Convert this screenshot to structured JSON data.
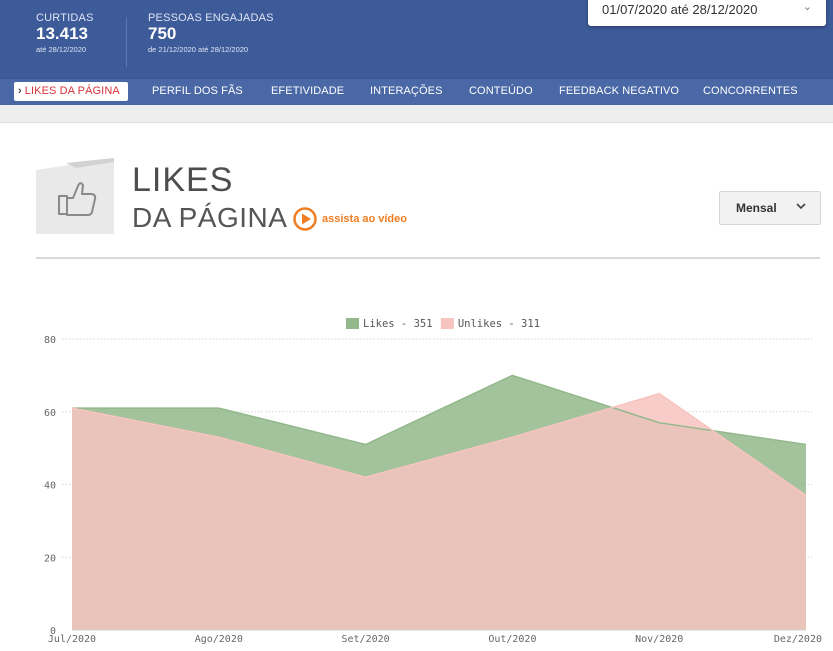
{
  "header": {
    "stats": [
      {
        "label": "CURTIDAS",
        "value": "13.413",
        "sub": "até 28/12/2020"
      },
      {
        "label": "PESSOAS ENGAJADAS",
        "value": "750",
        "sub": "de 21/12/2020 até 28/12/2020"
      }
    ],
    "date_range": "01/07/2020 até 28/12/2020"
  },
  "nav": {
    "items": [
      "LIKES DA PÁGINA",
      "PERFIL DOS FÃS",
      "EFETIVIDADE",
      "INTERAÇÕES",
      "CONTEÚDO",
      "FEEDBACK NEGATIVO",
      "CONCORRENTES"
    ],
    "active_index": 0
  },
  "page": {
    "title_line1": "LIKES",
    "title_line2": "DA PÁGINA",
    "video_link": "assista ao vídeo",
    "period_select": "Mensal"
  },
  "colors": {
    "header_bg": "#3d5a99",
    "nav_bg": "#4a68a6",
    "active_nav_text": "#d9333a",
    "likes": "#93b88b",
    "unlikes": "#f7c4bf",
    "video_orange": "#ef7d22"
  },
  "chart_data": {
    "type": "area",
    "categories": [
      "Jul/2020",
      "Ago/2020",
      "Set/2020",
      "Out/2020",
      "Nov/2020",
      "Dez/2020"
    ],
    "series": [
      {
        "name": "Likes - 351",
        "values": [
          61,
          61,
          51,
          70,
          57,
          51
        ],
        "color": "#93b88b"
      },
      {
        "name": "Unlikes - 311",
        "values": [
          61,
          53,
          42,
          53,
          65,
          37
        ],
        "color": "#f7c4bf"
      }
    ],
    "ylim": [
      0,
      80
    ],
    "yticks": [
      0,
      20,
      40,
      60,
      80
    ],
    "grid": true,
    "legend": "top-center"
  }
}
